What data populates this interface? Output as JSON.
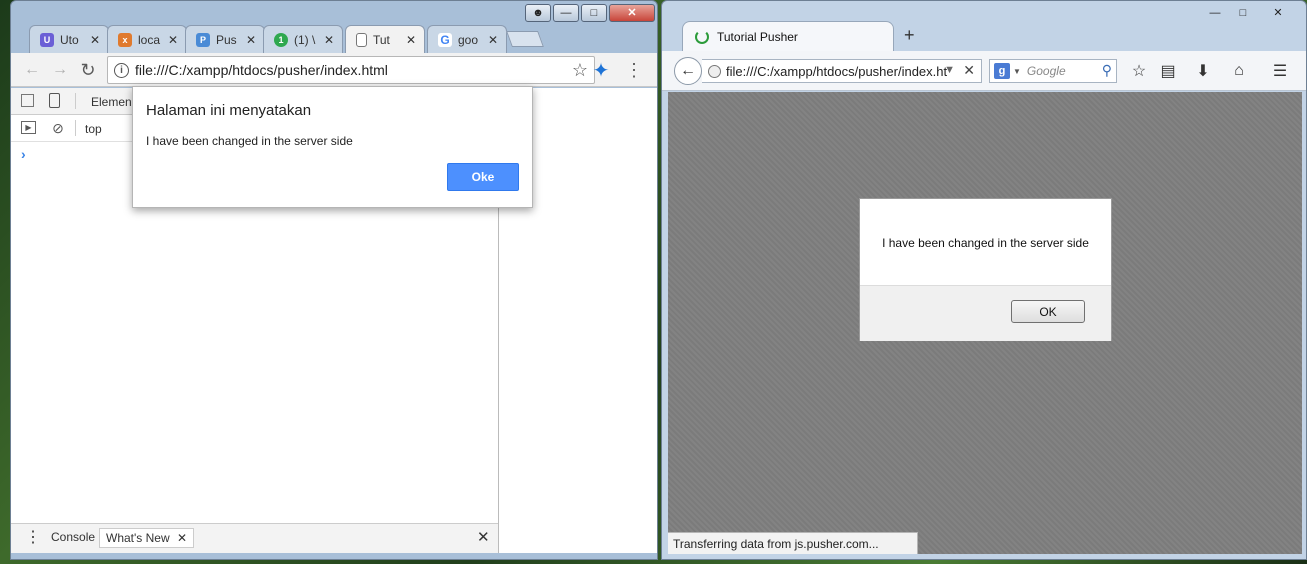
{
  "chrome": {
    "tabs": [
      {
        "label": "Uto",
        "favicon_color": "#6b5fd6",
        "favicon_char": "U"
      },
      {
        "label": "loca",
        "favicon_color": "#e07a2e",
        "favicon_char": "x"
      },
      {
        "label": "Pus",
        "favicon_color": "#4a8bd6",
        "favicon_char": "P"
      },
      {
        "label": "(1) \\",
        "favicon_color": "#2fa84f",
        "favicon_char": "1"
      },
      {
        "label": "Tut",
        "favicon_color": "#ffffff",
        "favicon_char": ""
      },
      {
        "label": "goo",
        "favicon_color": "#ffffff",
        "favicon_char": "G"
      }
    ],
    "url": "file:///C:/xampp/htdocs/pusher/index.html",
    "devtools": {
      "tab_elements": "Elemen",
      "context": "top",
      "drawer_tabs": [
        "Console",
        "What's New"
      ]
    },
    "alert": {
      "title": "Halaman ini menyatakan",
      "message": "I have been changed in the server side",
      "button": "Oke"
    }
  },
  "firefox": {
    "tab_title": "Tutorial Pusher",
    "url": "file:///C:/xampp/htdocs/pusher/index.ht",
    "search_placeholder": "Google",
    "dialog": {
      "message": "I have been changed in the server side",
      "button": "OK"
    },
    "status": "Transferring data from js.pusher.com..."
  },
  "icons": {
    "chrome_extension": "pinwheel-icon",
    "accent_blue": "#4d90fe"
  }
}
